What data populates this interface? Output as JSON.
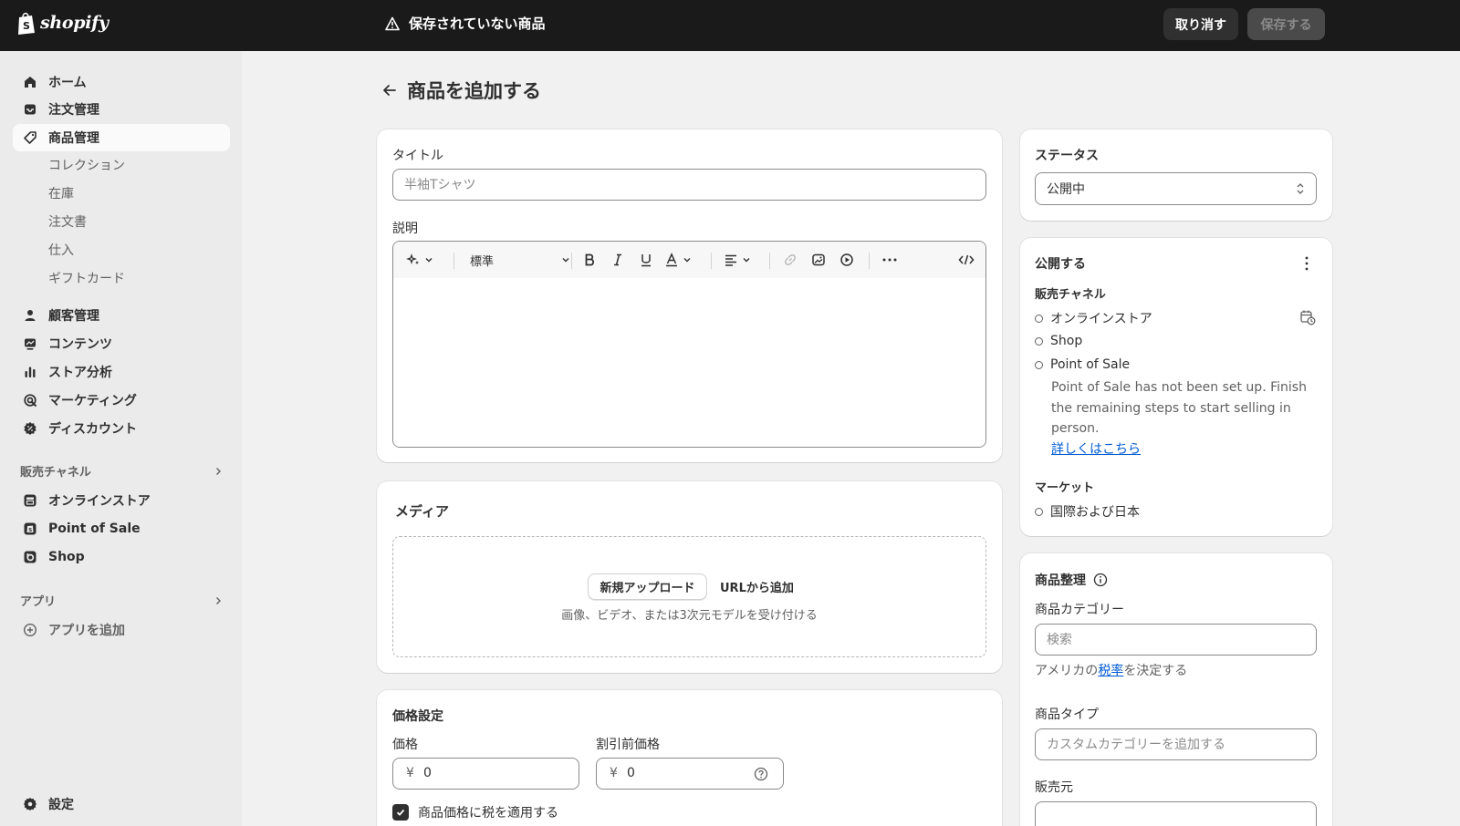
{
  "topbar": {
    "logo_text": "shopify",
    "unsaved_text": "保存されていない商品",
    "discard_label": "取り消す",
    "save_label": "保存する"
  },
  "sidebar": {
    "items": [
      {
        "label": "ホーム",
        "icon": "home-icon"
      },
      {
        "label": "注文管理",
        "icon": "inbox-icon"
      },
      {
        "label": "商品管理",
        "icon": "tag-icon",
        "active": true
      }
    ],
    "subitems": [
      "コレクション",
      "在庫",
      "注文書",
      "仕入",
      "ギフトカード"
    ],
    "items2": [
      {
        "label": "顧客管理",
        "icon": "person-icon"
      },
      {
        "label": "コンテンツ",
        "icon": "content-icon"
      },
      {
        "label": "ストア分析",
        "icon": "bar-chart-icon"
      },
      {
        "label": "マーケティング",
        "icon": "target-icon"
      },
      {
        "label": "ディスカウント",
        "icon": "discount-icon"
      }
    ],
    "channels_heading": "販売チャネル",
    "channels": [
      {
        "label": "オンラインストア",
        "icon": "store-icon"
      },
      {
        "label": "Point of Sale",
        "icon": "pos-icon"
      },
      {
        "label": "Shop",
        "icon": "shop-icon"
      }
    ],
    "apps_heading": "アプリ",
    "add_app_label": "アプリを追加",
    "settings_label": "設定"
  },
  "page": {
    "title": "商品を追加する"
  },
  "product": {
    "title_label": "タイトル",
    "title_placeholder": "半袖Tシャツ",
    "description_label": "説明",
    "editor": {
      "format_label": "標準"
    }
  },
  "media": {
    "title": "メディア",
    "upload_label": "新規アップロード",
    "url_label": "URLから追加",
    "hint": "画像、ビデオ、または3次元モデルを受け付ける"
  },
  "pricing": {
    "title": "価格設定",
    "price_label": "価格",
    "price_currency": "¥",
    "price_value": "0",
    "compare_label": "割引前価格",
    "compare_currency": "¥",
    "compare_value": "0",
    "tax_label": "商品価格に税を適用する",
    "tax_checked": true
  },
  "status": {
    "title": "ステータス",
    "value": "公開中"
  },
  "publishing": {
    "title": "公開する",
    "channels_heading": "販売チャネル",
    "channels": [
      "オンラインストア",
      "Shop",
      "Point of Sale"
    ],
    "pos_note": "Point of Sale has not been set up. Finish the remaining steps to start selling in person.",
    "learn_more": "詳しくはこちら",
    "markets_heading": "マーケット",
    "market": "国際および日本"
  },
  "organization": {
    "title": "商品整理",
    "category_label": "商品カテゴリー",
    "category_placeholder": "検索",
    "tax_hint_prefix": "アメリカの",
    "tax_hint_link": "税率",
    "tax_hint_suffix": "を決定する",
    "type_label": "商品タイプ",
    "type_placeholder": "カスタムカテゴリーを追加する",
    "vendor_label": "販売元"
  }
}
